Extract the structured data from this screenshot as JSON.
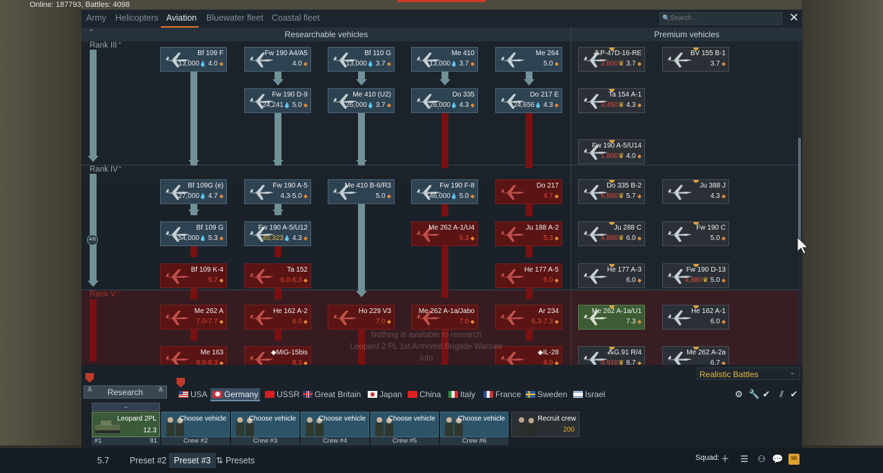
{
  "status": {
    "online": "Online: 187793, Battles: 4098"
  },
  "tabs": [
    "Army",
    "Helicopters",
    "Aviation",
    "Bluewater fleet",
    "Coastal fleet"
  ],
  "active_tab": "Aviation",
  "search": {
    "placeholder": "Search..."
  },
  "headers": {
    "researchable": "Researchable vehicles",
    "premium": "Premium vehicles"
  },
  "ranks": {
    "r3": "Rank III",
    "r4": "Rank IV",
    "r5": "Rank V"
  },
  "progress_badge": "4/6",
  "vehicles": [
    {
      "name": "Bf 109 F",
      "cost": "13,000",
      "br": "4.0"
    },
    {
      "name": "Fw 190 A4/A5",
      "cost": "",
      "br": "4.0"
    },
    {
      "name": "Bf 110 G",
      "cost": "13,000",
      "br": "3.7"
    },
    {
      "name": "Me 410",
      "cost": "13,000",
      "br": "3.7"
    },
    {
      "name": "Me 264",
      "cost": "",
      "br": "5.0"
    },
    {
      "name": "Fw 190 D-9",
      "cost": "24,241",
      "br": "5.0"
    },
    {
      "name": "Me 410 (U2)",
      "cost": "26,000",
      "br": "3.7"
    },
    {
      "name": "Do 335",
      "cost": "26,000",
      "br": "4.3"
    },
    {
      "name": "Do 217 E",
      "cost": "24,656",
      "br": "4.3"
    },
    {
      "name": "Bf 109G (e)",
      "cost": "27,000",
      "br": "4.7"
    },
    {
      "name": "Fw 190 A-5",
      "cost": "",
      "br": "4.3-5.0"
    },
    {
      "name": "Me 410 B-6/R3",
      "cost": "",
      "br": "5.0"
    },
    {
      "name": "Fw 190 F-8",
      "cost": "46,000",
      "br": "5.0"
    },
    {
      "name": "Do 217",
      "cost": "",
      "br": "4.7"
    },
    {
      "name": "Bf 109 G",
      "cost": "54,000",
      "br": "5.3"
    },
    {
      "name": "Fw 190 A-5/U12",
      "cost": "45,323",
      "br": "4.3"
    },
    {
      "name": "Me 262 A-1/U4",
      "cost": "",
      "br": "6.3"
    },
    {
      "name": "Ju 188 A-2",
      "cost": "",
      "br": "5.3"
    },
    {
      "name": "Bf 109 K-4",
      "cost": "",
      "br": "5.7"
    },
    {
      "name": "Ta 152",
      "cost": "",
      "br": "6.0-6.3"
    },
    {
      "name": "He 177 A-5",
      "cost": "",
      "br": "6.0"
    },
    {
      "name": "Me 262 A",
      "cost": "",
      "br": "7.0-7.7"
    },
    {
      "name": "He 162 A-2",
      "cost": "",
      "br": "6.0"
    },
    {
      "name": "Ho 229 V3",
      "cost": "",
      "br": "7.0"
    },
    {
      "name": "Me 262 A-1a/Jabo",
      "cost": "",
      "br": "7.0"
    },
    {
      "name": "Ar 234",
      "cost": "",
      "br": "6.3-7.3"
    },
    {
      "name": "Me 163",
      "cost": "",
      "br": "8.0-8.3"
    },
    {
      "name": "◆MiG-15bis",
      "cost": "",
      "br": "8.3"
    },
    {
      "name": "◆IL-28",
      "cost": "",
      "br": "8.0"
    }
  ],
  "premium": [
    {
      "name": "⁂P-47D-16-RE",
      "cost": "2,600",
      "br": "3.7"
    },
    {
      "name": "BV 155 B-1",
      "cost": "",
      "br": "3.7"
    },
    {
      "name": "Ta 154 A-1",
      "cost": "3,450",
      "br": "4.3"
    },
    {
      "name": "Fw 190 A-5/U14",
      "cost": "1,800",
      "br": "4.0"
    },
    {
      "name": "Do 335 B-2",
      "cost": "6,880",
      "br": "5.7"
    },
    {
      "name": "Ju 388 J",
      "cost": "",
      "br": "4.3"
    },
    {
      "name": "Ju 288 C",
      "cost": "4,880",
      "br": "6.0"
    },
    {
      "name": "Fw 190 C",
      "cost": "",
      "br": "5.0"
    },
    {
      "name": "He 177 A-3",
      "cost": "",
      "br": "6.0"
    },
    {
      "name": "Fw 190 D-13",
      "cost": "4,880",
      "br": "5.0"
    },
    {
      "name": "Me 262 A-1a/U1",
      "cost": "",
      "br": "7.3"
    },
    {
      "name": "He 162 A-1",
      "cost": "",
      "br": "6.0"
    },
    {
      "name": "⁂G.91 R/4",
      "cost": "8,910",
      "br": "8.7"
    },
    {
      "name": "Me 262 A-2a",
      "cost": "",
      "br": "6.7"
    }
  ],
  "locked_message": [
    "Nothing is available to research",
    "Leopard 2 PL 1st Armored Brigade Warsaw",
    "Info"
  ],
  "mode": "Realistic Battles",
  "research_label": "Research",
  "nations": [
    "USA",
    "Germany",
    "USSR",
    "Great Britain",
    "Japan",
    "China",
    "Italy",
    "France",
    "Sweden",
    "Israel"
  ],
  "active_nation": "Germany",
  "crew": {
    "first": {
      "head": "–",
      "title": "Leopard 2PL",
      "br": "12.3",
      "slot": "#1",
      "value": "81"
    },
    "slots": [
      {
        "title": "Choose vehicle",
        "crew": "Crew #2"
      },
      {
        "title": "Choose vehicle",
        "crew": "Crew #3"
      },
      {
        "title": "Choose vehicle",
        "crew": "Crew #4"
      },
      {
        "title": "Choose vehicle",
        "crew": "Crew #5"
      },
      {
        "title": "Choose vehicle",
        "crew": "Crew #6"
      }
    ],
    "recruit": {
      "title": "Recruit crew",
      "price": "200"
    }
  },
  "bottom": {
    "br": "5.7",
    "presets": [
      "Preset #2",
      "Preset #3"
    ],
    "presets_btn": "Presets",
    "squad": "Squad:"
  }
}
